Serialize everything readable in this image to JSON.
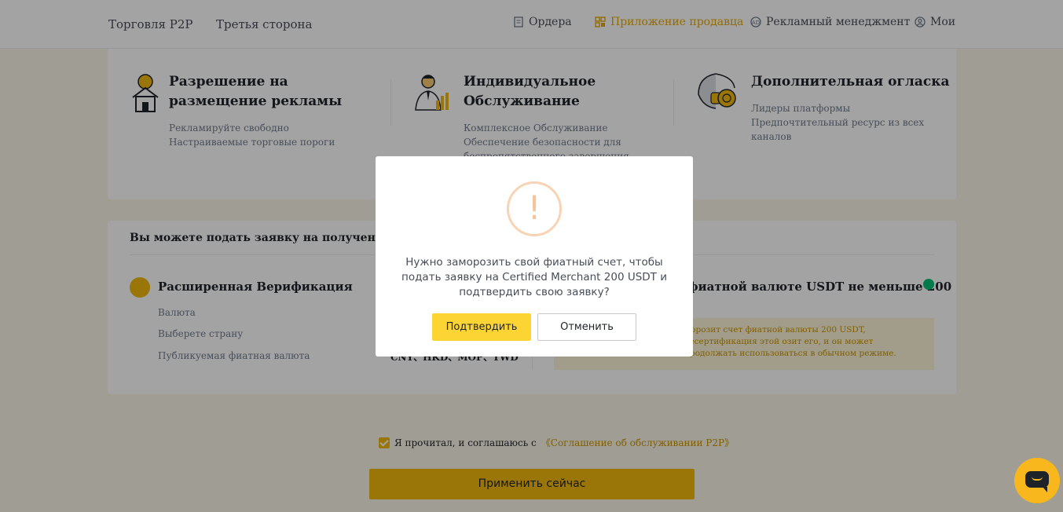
{
  "nav": {
    "left": [
      "Торговля P2P",
      "Третья сторона"
    ],
    "right": [
      {
        "label": "Ордера",
        "icon": "orders-icon"
      },
      {
        "label": "Приложение продавца",
        "icon": "merchant-app-icon",
        "active": true
      },
      {
        "label": "Рекламный менеджмент",
        "icon": "ad-management-icon"
      },
      {
        "label": "Мои",
        "icon": "user-icon"
      }
    ]
  },
  "features": [
    {
      "title": "Разрешение на размещение рекламы",
      "desc": [
        "Рекламируйте свободно",
        "Настраиваемые торговые пороги"
      ],
      "icon": "house-coin-icon"
    },
    {
      "title": "Индивидуальное Обслуживание",
      "desc": [
        "Комплексное Обслуживание",
        "Обеспечение безопасности для",
        "беспрепятственного завершения сделок"
      ],
      "icon": "person-chart-icon"
    },
    {
      "title": "Дополнительная огласка",
      "desc": [
        "Лидеры платформы",
        "Предпочтительный ресурс из всех каналов"
      ],
      "icon": "shield-coin-icon"
    }
  ],
  "apply_card": {
    "title": "Вы можете подать заявку на получение статуса т",
    "verification_title": "Расширенная Верификация",
    "rows": [
      {
        "label": "Валюта",
        "value": ""
      },
      {
        "label": "Выберете страну",
        "value": ""
      },
      {
        "label": "Публикуемая фиатная валюта",
        "value": "CNY、HKD、MOP、TWD"
      }
    ],
    "right_title": "фиатной валюте USDT не меньше 200",
    "notice": "морозит счет фиатной валюты 200 USDT, десертификация этой озит его, и он может продолжать использоваться в обычном режиме."
  },
  "agreement": {
    "text": "Я прочитал, и соглашаюсь с",
    "link": "《Соглашение об обслуживании P2P》"
  },
  "apply_button": "Применить сейчас",
  "modal": {
    "icon": "warning-icon",
    "glyph": "!",
    "message": "Нужно заморозить свой фиатный счет, чтобы подать заявку на Certified Merchant 200 USDT и подтвердить свою заявку?",
    "confirm": "Подтвердить",
    "cancel": "Отменить"
  },
  "colors": {
    "accent": "#f0b90b",
    "modal_confirm": "#fcd535",
    "success": "#02c076"
  }
}
